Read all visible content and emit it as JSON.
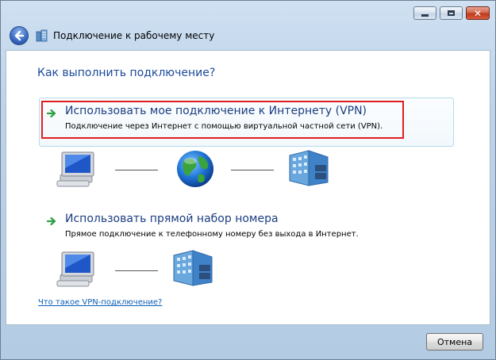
{
  "window": {
    "title": "Подключение к рабочему месту"
  },
  "main": {
    "question": "Как выполнить подключение?",
    "options": [
      {
        "title": "Использовать мое подключение к Интернету (VPN)",
        "description": "Подключение через Интернет с помощью виртуальной частной сети (VPN).",
        "icon": "green-arrow-icon",
        "highlighted": true
      },
      {
        "title": "Использовать прямой набор номера",
        "description": "Прямое подключение к телефонному номеру без выхода в Интернет.",
        "icon": "green-arrow-icon",
        "highlighted": false
      }
    ],
    "help_link": "Что такое VPN-подключение?"
  },
  "footer": {
    "cancel_label": "Отмена"
  },
  "colors": {
    "heading": "#1c4a9c",
    "link": "#0d5fb8",
    "highlight_border": "#e11e1e",
    "option_border": "#b3dcec"
  }
}
